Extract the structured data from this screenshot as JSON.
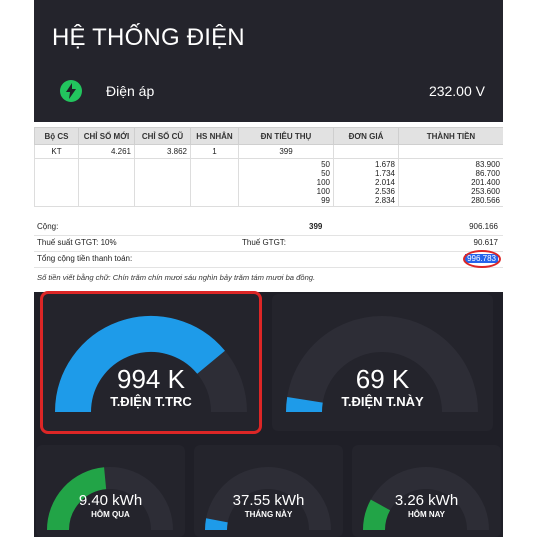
{
  "header": {
    "title": "HỆ THỐNG ĐIỆN"
  },
  "voltage": {
    "label": "Điện áp",
    "value": "232.00 V",
    "icon": "lightning-icon",
    "icon_color": "#22c55e"
  },
  "bill": {
    "headers": [
      "Bộ CS",
      "CHỈ SỐ MỚI",
      "CHỈ SỐ CŨ",
      "HS NHÂN",
      "ĐN TIÊU THỤ",
      "ĐƠN GIÁ",
      "THÀNH TIỀN"
    ],
    "row": {
      "bo_cs": "KT",
      "chi_so_moi": "4.261",
      "chi_so_cu": "3.862",
      "hs_nhan": "1",
      "dn_tieu_thu": "399"
    },
    "tiers": [
      {
        "kwh": "50",
        "price": "1.678",
        "amount": "83.900"
      },
      {
        "kwh": "50",
        "price": "1.734",
        "amount": "86.700"
      },
      {
        "kwh": "100",
        "price": "2.014",
        "amount": "201.400"
      },
      {
        "kwh": "100",
        "price": "2.536",
        "amount": "253.600"
      },
      {
        "kwh": "99",
        "price": "2.834",
        "amount": "280.566"
      }
    ],
    "cong_label": "Cộng:",
    "cong_kwh": "399",
    "cong_amount": "906.166",
    "vat_rate_label": "Thuế suất GTGT: 10%",
    "vat_label": "Thuế GTGT:",
    "vat_amount": "90.617",
    "total_label": "Tổng cộng tiền thanh toán:",
    "total_amount": "996.783",
    "words": "Số tiền viết bằng chữ: Chín trăm chín mươi sáu nghìn bảy trăm tám mươi ba đồng."
  },
  "gauges": {
    "prev_month": {
      "value": "994 K",
      "label": "T.ĐIỆN T.TRC",
      "fraction": 0.78,
      "color": "#1e9be9"
    },
    "this_month": {
      "value": "69 K",
      "label": "T.ĐIỆN T.NÀY",
      "fraction": 0.05,
      "color": "#1e9be9"
    },
    "yesterday": {
      "value": "9.40 kWh",
      "label": "HÔM QUA",
      "fraction": 0.47,
      "color": "#22a447"
    },
    "month_kwh": {
      "value": "37.55 kWh",
      "label": "THÁNG NÀY",
      "fraction": 0.06,
      "color": "#1e9be9"
    },
    "today": {
      "value": "3.26 kWh",
      "label": "HÔM NAY",
      "fraction": 0.16,
      "color": "#22a447"
    }
  },
  "colors": {
    "track": "#2d2d36",
    "highlight": "#dc2626"
  }
}
